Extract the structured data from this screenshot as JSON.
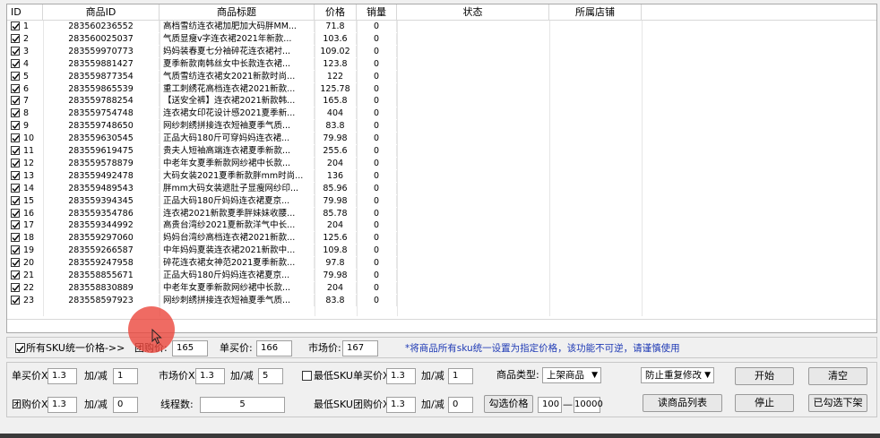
{
  "table": {
    "columns": [
      "ID",
      "商品ID",
      "商品标题",
      "价格",
      "销量",
      "状态",
      "所属店铺"
    ],
    "rows": [
      {
        "id": "1",
        "pid": "283560236552",
        "title": "高档雪纺连衣裙加肥加大码胖MM...",
        "price": "71.8",
        "sales": "0"
      },
      {
        "id": "2",
        "pid": "283560025037",
        "title": " 气质显瘦v字连衣裙2021年新款...",
        "price": "103.6",
        "sales": "0"
      },
      {
        "id": "3",
        "pid": "283559970773",
        "title": "妈妈装春夏七分袖碎花连衣裙衬...",
        "price": "109.02",
        "sales": "0"
      },
      {
        "id": "4",
        "pid": "283559881427",
        "title": "夏季新款南韩丝女中长款连衣裙...",
        "price": "123.8",
        "sales": "0"
      },
      {
        "id": "5",
        "pid": "283559877354",
        "title": "气质雪纺连衣裙女2021新款时尚...",
        "price": "122",
        "sales": "0"
      },
      {
        "id": "6",
        "pid": "283559865539",
        "title": "重工刺绣花高档连衣裙2021新款...",
        "price": "125.78",
        "sales": "0"
      },
      {
        "id": "7",
        "pid": "283559788254",
        "title": "【送安全裤】连衣裙2021新款韩...",
        "price": "165.8",
        "sales": "0"
      },
      {
        "id": "8",
        "pid": "283559754748",
        "title": "连衣裙女印花设计感2021夏季新...",
        "price": "404",
        "sales": "0"
      },
      {
        "id": "9",
        "pid": "283559748650",
        "title": "网纱刺绣拼接连衣短袖夏季气质...",
        "price": "83.8",
        "sales": "0"
      },
      {
        "id": "10",
        "pid": "283559630545",
        "title": " 正品大码180斤可穿妈妈连衣裙...",
        "price": "79.98",
        "sales": "0"
      },
      {
        "id": "11",
        "pid": "283559619475",
        "title": "贵夫人短袖高端连衣裙夏季新款...",
        "price": "255.6",
        "sales": "0"
      },
      {
        "id": "12",
        "pid": "283559578879",
        "title": "中老年女夏季新款网纱裙中长款...",
        "price": "204",
        "sales": "0"
      },
      {
        "id": "13",
        "pid": "283559492478",
        "title": "大码女装2021夏季新款胖mm时尚...",
        "price": "136",
        "sales": "0"
      },
      {
        "id": "14",
        "pid": "283559489543",
        "title": "胖mm大码女装遮肚子显瘦网纱印...",
        "price": "85.96",
        "sales": "0"
      },
      {
        "id": "15",
        "pid": "283559394345",
        "title": " 正品大码180斤妈妈连衣裙夏京...",
        "price": "79.98",
        "sales": "0"
      },
      {
        "id": "16",
        "pid": "283559354786",
        "title": "连衣裙2021新款夏季胖妹妹收腰...",
        "price": "85.78",
        "sales": "0"
      },
      {
        "id": "17",
        "pid": "283559344992",
        "title": "高贵台湾纱2021夏新款洋气中长...",
        "price": "204",
        "sales": "0"
      },
      {
        "id": "18",
        "pid": "283559297060",
        "title": "妈妈台湾纱高档连衣裙2021新款...",
        "price": "125.6",
        "sales": "0"
      },
      {
        "id": "19",
        "pid": "283559266587",
        "title": "中年妈妈夏装连衣裙2021新款中...",
        "price": "109.8",
        "sales": "0"
      },
      {
        "id": "20",
        "pid": "283559247958",
        "title": "碎花连衣裙女神范2021夏季新款...",
        "price": "97.8",
        "sales": "0"
      },
      {
        "id": "21",
        "pid": "283558855671",
        "title": " 正品大码180斤妈妈连衣裙夏京...",
        "price": "79.98",
        "sales": "0"
      },
      {
        "id": "22",
        "pid": "283558830889",
        "title": "中老年女夏季新款网纱裙中长款...",
        "price": "204",
        "sales": "0"
      },
      {
        "id": "23",
        "pid": "283558597923",
        "title": "网纱刺绣拼接连衣短袖夏季气质...",
        "price": "83.8",
        "sales": "0"
      }
    ]
  },
  "unify": {
    "checkbox_label": "所有SKU统一价格->>",
    "group_price_label": "团购价:",
    "group_price_value": "165",
    "single_price_label": "单买价:",
    "single_price_value": "166",
    "market_price_label": "市场价:",
    "market_price_value": "167",
    "note": "*将商品所有sku统一设置为指定价格，该功能不可逆，请谨慎使用"
  },
  "settings": {
    "single_mult_label": "单买价X",
    "single_mult_value": "1.3",
    "single_add_label": "加/减",
    "single_add_value": "1",
    "market_mult_label": "市场价X",
    "market_mult_value": "1.3",
    "market_add_label": "加/减",
    "market_add_value": "5",
    "min_sku_single_label": "最低SKU单买价X",
    "min_sku_single_value": "1.3",
    "min_sku_single_add_label": "加/减",
    "min_sku_single_add_value": "1",
    "product_type_label": "商品类型:",
    "product_type_value": "上架商品",
    "anti_dup_value": "防止重复修改",
    "start_button": "开始",
    "clear_button": "清空",
    "group_mult_label": "团购价X",
    "group_mult_value": "1.3",
    "group_add_label": "加/减",
    "group_add_value": "0",
    "threads_label": "线程数:",
    "threads_value": "5",
    "min_sku_group_label": "最低SKU团购价X",
    "min_sku_group_value": "1.3",
    "min_sku_group_add_label": "加/减",
    "min_sku_group_add_value": "0",
    "select_price_button": "勾选价格",
    "price_from": "100",
    "price_dash": "—",
    "price_to": "10000",
    "read_list_button": "读商品列表",
    "stop_button": "停止",
    "delist_button": "已勾选下架"
  },
  "colors": {
    "note_color": "#1f3ab5",
    "cursor_highlight": "#eb463c"
  }
}
